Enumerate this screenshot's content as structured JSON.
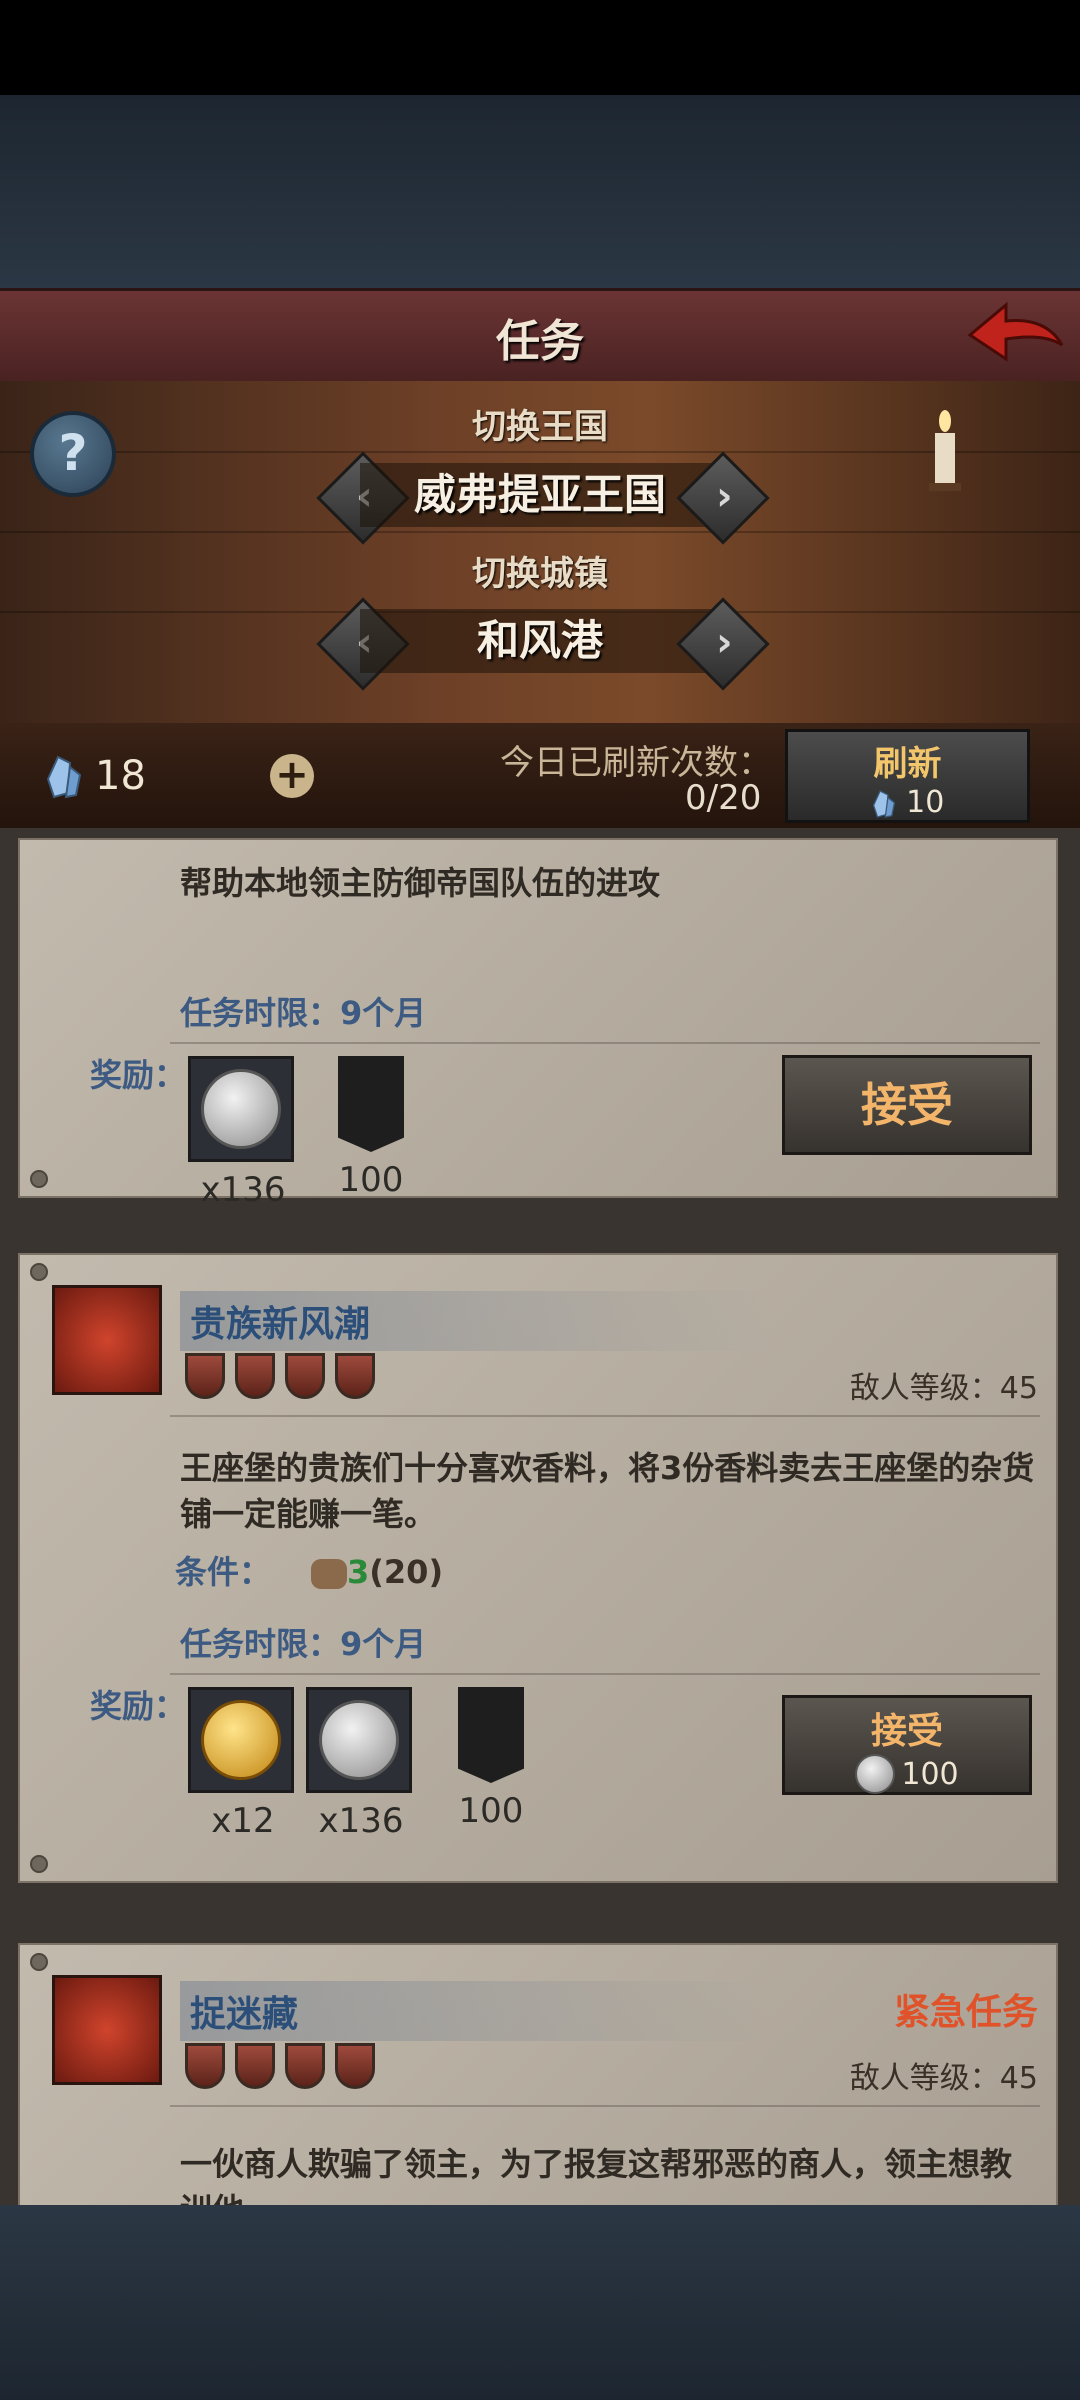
{
  "header": {
    "title": "任务",
    "switch_kingdom_label": "切换王国",
    "kingdom_name": "威弗提亚王国",
    "switch_town_label": "切换城镇",
    "town_name": "和风港"
  },
  "currency": {
    "gems": "18",
    "refresh_label": "今日已刷新次数：",
    "refresh_count": "0/20",
    "refresh_button": "刷新",
    "refresh_cost": "10"
  },
  "quests": [
    {
      "description": "帮助本地领主防御帝国队伍的进攻",
      "time_limit": "任务时限：9个月",
      "reward_label": "奖励：",
      "rewards": [
        {
          "icon": "silver-coin-icon",
          "qty": "x136"
        },
        {
          "icon": "scales-banner-icon",
          "qty": "100"
        }
      ],
      "accept_label": "接受"
    },
    {
      "name": "贵族新风潮",
      "enemy_level": "敌人等级：45",
      "description": "王座堡的贵族们十分喜欢香料，将3份香料卖去王座堡的杂货铺一定能赚一笔。",
      "condition_label": "条件：",
      "condition_have": "3",
      "condition_need": "(20)",
      "time_limit": "任务时限：9个月",
      "reward_label": "奖励：",
      "rewards": [
        {
          "icon": "gold-coin-icon",
          "qty": "x12"
        },
        {
          "icon": "silver-coin-icon",
          "qty": "x136"
        },
        {
          "icon": "chest-banner-icon",
          "qty": "100"
        }
      ],
      "accept_label": "接受",
      "accept_cost": "100"
    },
    {
      "name": "捉迷藏",
      "urgent_label": "紧急任务",
      "enemy_level": "敌人等级：45",
      "description": "一伙商人欺骗了领主，为了报复这帮邪恶的商人，领主想教训他"
    }
  ]
}
